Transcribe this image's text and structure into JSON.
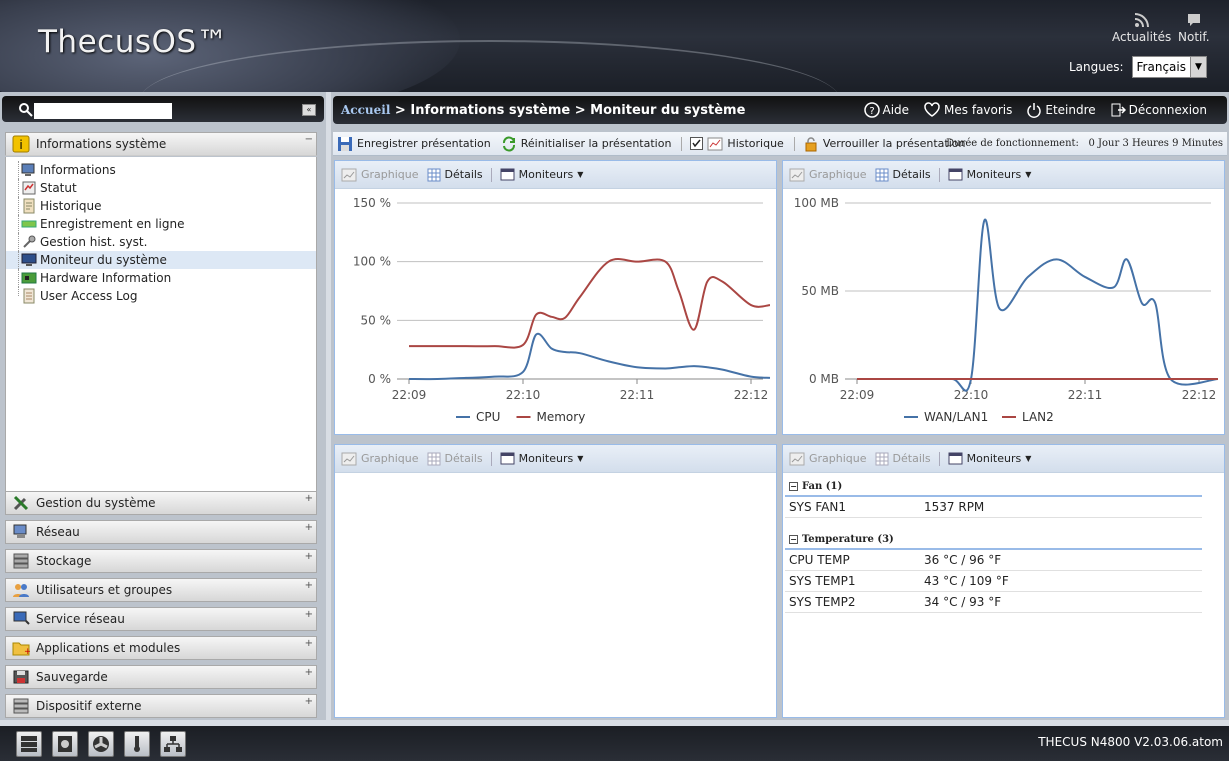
{
  "header": {
    "logo": "ThecusOS™",
    "news_label": "Actualités",
    "notif_label": "Notif.",
    "language_label": "Langues:",
    "language_value": "Français"
  },
  "sidebar": {
    "search_placeholder": "",
    "top_section": "Informations système",
    "tree_items": [
      {
        "label": "Informations",
        "icon": "info-icon"
      },
      {
        "label": "Statut",
        "icon": "status-icon"
      },
      {
        "label": "Historique",
        "icon": "history-icon"
      },
      {
        "label": "Enregistrement en ligne",
        "icon": "online-register-icon"
      },
      {
        "label": "Gestion hist. syst.",
        "icon": "log-management-icon"
      },
      {
        "label": "Moniteur du système",
        "icon": "monitor-icon",
        "selected": true
      },
      {
        "label": "Hardware Information",
        "icon": "hardware-icon"
      },
      {
        "label": "User Access Log",
        "icon": "access-log-icon"
      }
    ],
    "sections": [
      "Gestion du système",
      "Réseau",
      "Stockage",
      "Utilisateurs et groupes",
      "Service réseau",
      "Applications et modules",
      "Sauvegarde",
      "Dispositif externe"
    ]
  },
  "breadcrumb": {
    "home": "Accueil",
    "rest": " > Informations système > Moniteur du système"
  },
  "top_actions": {
    "help": "Aide",
    "favorites": "Mes favoris",
    "shutdown": "Eteindre",
    "logout": "Déconnexion"
  },
  "toolbar": {
    "save": "Enregistrer présentation",
    "reset": "Réinitialiser la présentation",
    "history": "Historique",
    "lock": "Verrouiller la présentation",
    "uptime_label": "Durée de fonctionnement:",
    "uptime_value": "0 Jour 3 Heures 9 Minutes"
  },
  "panel_tools": {
    "graph": "Graphique",
    "details": "Détails",
    "monitors": "Moniteurs"
  },
  "chart_data": [
    {
      "type": "line",
      "x": [
        "22:09:00",
        "22:09:15",
        "22:09:30",
        "22:09:45",
        "22:10:00",
        "22:10:07",
        "22:10:15",
        "22:10:22",
        "22:10:30",
        "22:10:45",
        "22:11:00",
        "22:11:15",
        "22:11:22",
        "22:11:30",
        "22:11:37",
        "22:11:45",
        "22:12:00",
        "22:12:10"
      ],
      "xticks": [
        "22:09",
        "22:10",
        "22:11",
        "22:12"
      ],
      "yticks": [
        "0 %",
        "50 %",
        "100 %",
        "150 %"
      ],
      "ylim": [
        0,
        150
      ],
      "legend": "bottom",
      "series": [
        {
          "name": "CPU",
          "color": "#4572a7",
          "values": [
            0,
            0,
            1,
            2,
            6,
            38,
            26,
            23,
            22,
            15,
            10,
            9,
            10,
            11,
            10,
            8,
            2,
            1
          ]
        },
        {
          "name": "Memory",
          "color": "#aa4643",
          "values": [
            28,
            28,
            28,
            28,
            29,
            55,
            53,
            52,
            70,
            100,
            100,
            100,
            75,
            42,
            83,
            83,
            63,
            63
          ]
        }
      ]
    },
    {
      "type": "line",
      "x": [
        "22:09:00",
        "22:09:30",
        "22:09:50",
        "22:10:00",
        "22:10:07",
        "22:10:15",
        "22:10:30",
        "22:10:45",
        "22:11:00",
        "22:11:15",
        "22:11:22",
        "22:11:30",
        "22:11:37",
        "22:11:45",
        "22:12:10"
      ],
      "xticks": [
        "22:09",
        "22:10",
        "22:11",
        "22:12"
      ],
      "yticks": [
        "0 MB",
        "50 MB",
        "100 MB"
      ],
      "ylim": [
        0,
        100
      ],
      "legend": "bottom",
      "series": [
        {
          "name": "WAN/LAN1",
          "color": "#4572a7",
          "values": [
            0,
            0,
            0,
            0,
            90,
            40,
            58,
            68,
            58,
            52,
            68,
            43,
            43,
            0,
            0
          ]
        },
        {
          "name": "LAN2",
          "color": "#aa4643",
          "values": [
            0,
            0,
            0,
            0,
            0,
            0,
            0,
            0,
            0,
            0,
            0,
            0,
            0,
            0,
            0
          ]
        }
      ]
    }
  ],
  "sensors": {
    "fan_group": "Fan (1)",
    "fans": [
      {
        "name": "SYS FAN1",
        "value": "1537 RPM"
      }
    ],
    "temp_group": "Temperature (3)",
    "temps": [
      {
        "name": "CPU TEMP",
        "value": "36 °C / 96 °F"
      },
      {
        "name": "SYS TEMP1",
        "value": "43 °C / 109 °F"
      },
      {
        "name": "SYS TEMP2",
        "value": "34 °C / 93 °F"
      }
    ]
  },
  "footer": {
    "version": "THECUS N4800 V2.03.06.atom"
  },
  "colors": {
    "accent_blue": "#99bbe8",
    "header_dark": "#1e222b",
    "cpu_line": "#4572a7",
    "memory_line": "#aa4643"
  }
}
